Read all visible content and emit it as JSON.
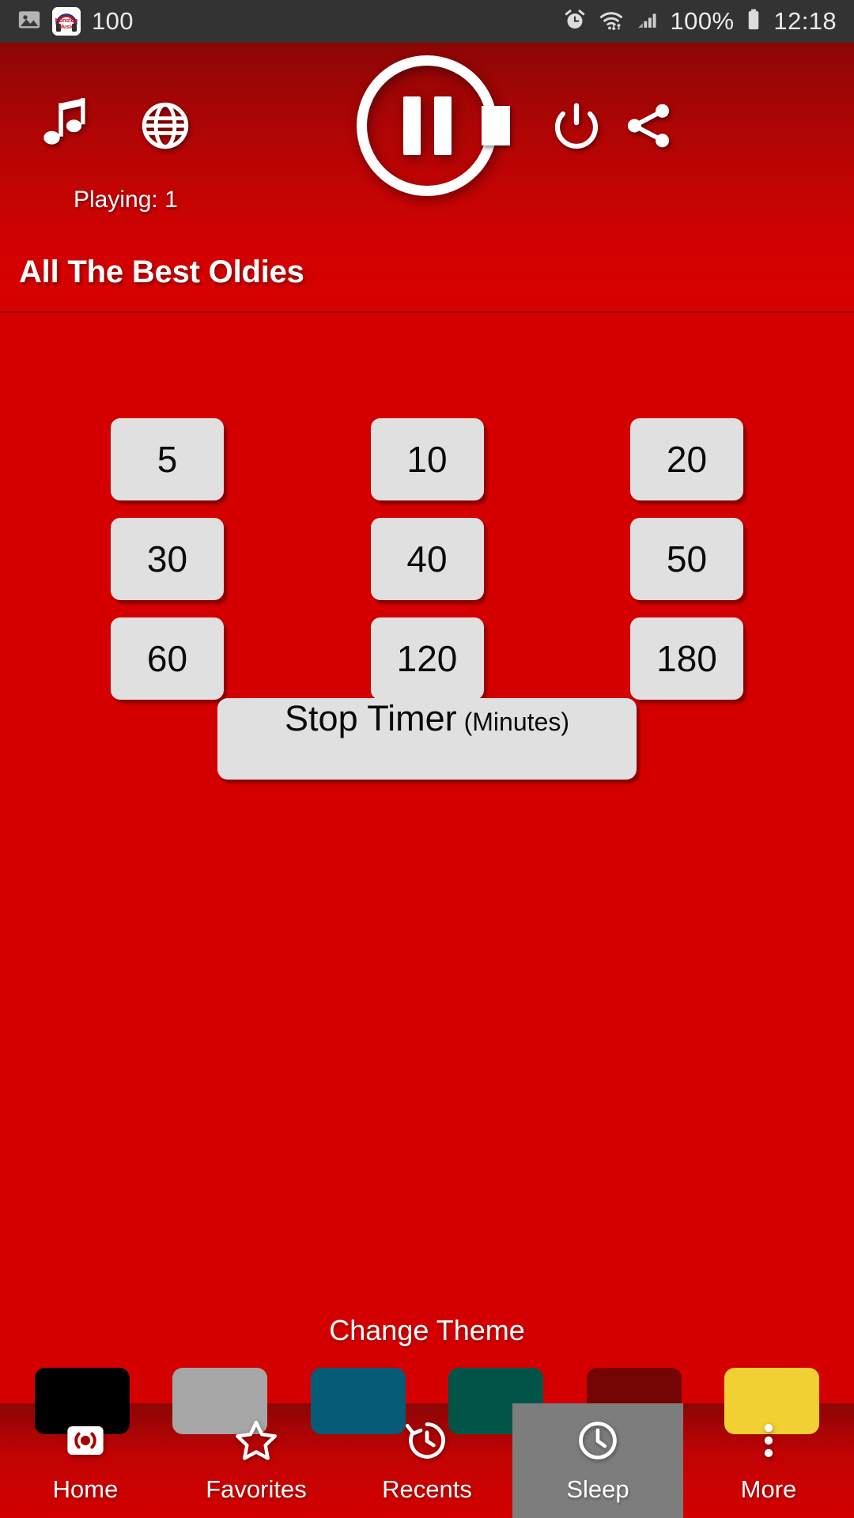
{
  "statusbar": {
    "left_icons": [
      "image-icon",
      "app-notification-icon"
    ],
    "notification_count": "100",
    "app_badge_line1": "Nonstop",
    "app_badge_line2": "Music",
    "right_icons": [
      "alarm-icon",
      "wifi-icon",
      "signal-icon",
      "battery-icon"
    ],
    "battery_percent": "100%",
    "clock": "12:18"
  },
  "header": {
    "music_icon": "music-note-icon",
    "globe_icon": "globe-icon",
    "playing_label": "Playing: 1",
    "play_pause_icon": "pause-icon",
    "stop_icon": "stop-square-icon",
    "power_icon": "power-icon",
    "share_icon": "share-icon",
    "station_title": "All The Best Oldies"
  },
  "sleep_timer": {
    "rows": [
      [
        "5",
        "10",
        "20"
      ],
      [
        "30",
        "40",
        "50"
      ],
      [
        "60",
        "120",
        "180"
      ]
    ],
    "stop_label": "Stop Timer",
    "stop_unit": "(Minutes)"
  },
  "theme": {
    "title": "Change Theme",
    "swatches": [
      {
        "name": "black",
        "color": "#000000"
      },
      {
        "name": "grey",
        "color": "#a6a6a6"
      },
      {
        "name": "teal-blue",
        "color": "#065b77"
      },
      {
        "name": "green",
        "color": "#035448"
      },
      {
        "name": "dark-red",
        "color": "#750505"
      },
      {
        "name": "yellow",
        "color": "#f0d033"
      }
    ]
  },
  "navbar": {
    "items": [
      {
        "label": "Home",
        "icon": "broadcast-icon",
        "selected": false
      },
      {
        "label": "Favorites",
        "icon": "star-icon",
        "selected": false
      },
      {
        "label": "Recents",
        "icon": "history-icon",
        "selected": false
      },
      {
        "label": "Sleep",
        "icon": "clock-icon",
        "selected": true
      },
      {
        "label": "More",
        "icon": "more-dots-icon",
        "selected": false
      }
    ]
  },
  "colors": {
    "brand_red": "#d40000",
    "header_dark": "#8d0606",
    "button_grey": "#e0e0e0",
    "selected_nav": "#7d7d7d",
    "statusbar_bg": "#333333"
  }
}
